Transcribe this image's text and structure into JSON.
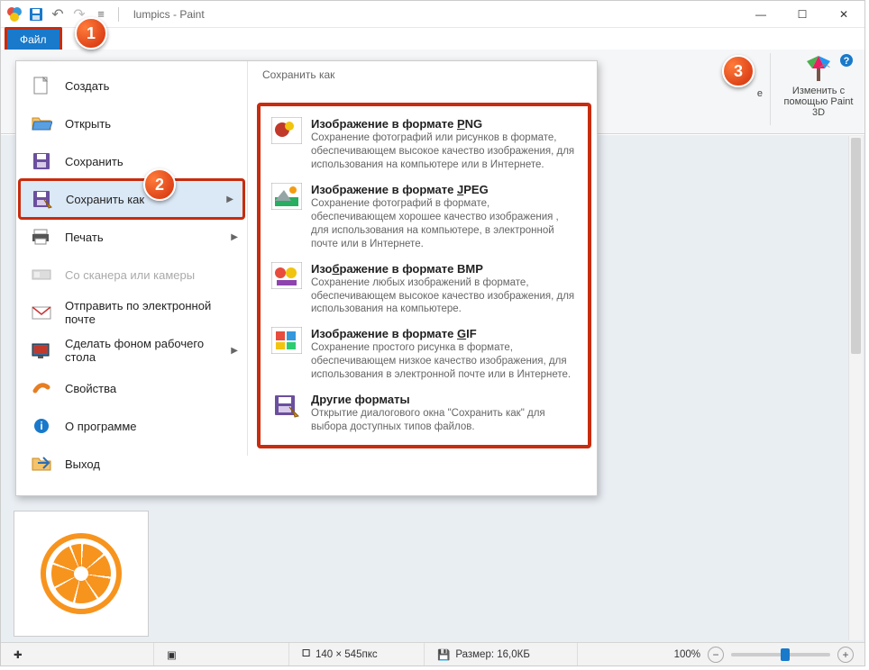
{
  "window": {
    "title": "lumpics - Paint"
  },
  "tabs": {
    "file": "Файл"
  },
  "ribbon": {
    "paint3d_line1": "Изменить с",
    "paint3d_line2": "помощью Paint 3D",
    "partial_e": "е"
  },
  "file_menu": {
    "create": "Создать",
    "open": "Открыть",
    "save": "Сохранить",
    "save_as": "Сохранить как",
    "print": "Печать",
    "scanner": "Со сканера или камеры",
    "email": "Отправить по электронной почте",
    "wallpaper": "Сделать фоном рабочего стола",
    "properties": "Свойства",
    "about": "О программе",
    "exit": "Выход"
  },
  "submenu": {
    "title": "Сохранить как",
    "items": [
      {
        "t_pre": "Изображение в формате ",
        "t_u": "P",
        "t_post": "NG",
        "d": "Сохранение фотографий или рисунков в формате, обеспечивающем высокое качество изображения, для использования на компьютере или в Интернете."
      },
      {
        "t_pre": "Изображение в формате ",
        "t_u": "J",
        "t_post": "PEG",
        "d": "Сохранение фотографий в формате, обеспечивающем хорошее качество изображения , для использования на компьютере, в электронной почте или в Интернете."
      },
      {
        "t_pre": "Изо",
        "t_u": "б",
        "t_post": "ражение в формате BMP",
        "d": "Сохранение любых изображений в формате, обеспечивающем высокое качество изображения, для использования на компьютере."
      },
      {
        "t_pre": "Изображение в формате ",
        "t_u": "G",
        "t_post": "IF",
        "d": "Сохранение простого рисунка в формате, обеспечивающем низкое качество изображения, для использования в электронной почте или в Интернете."
      },
      {
        "t_pre": "",
        "t_u": "Д",
        "t_post": "ругие форматы",
        "d": "Открытие диалогового окна \"Сохранить как\" для выбора доступных типов файлов."
      }
    ]
  },
  "statusbar": {
    "dims": "140 × 545пкс",
    "size_label": "Размер: 16,0КБ",
    "zoom": "100%"
  },
  "badges": {
    "b1": "1",
    "b2": "2",
    "b3": "3"
  }
}
